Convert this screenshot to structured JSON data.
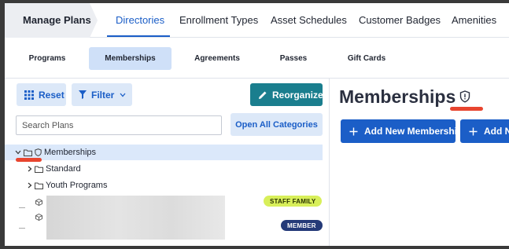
{
  "topnav": {
    "brand": "Manage Plans",
    "tabs": [
      {
        "label": "Directories",
        "active": true
      },
      {
        "label": "Enrollment Types",
        "active": false
      },
      {
        "label": "Asset Schedules",
        "active": false
      },
      {
        "label": "Customer Badges",
        "active": false
      },
      {
        "label": "Amenities",
        "active": false
      }
    ]
  },
  "subnav": {
    "tabs": [
      {
        "label": "Programs",
        "active": false
      },
      {
        "label": "Memberships",
        "active": true
      },
      {
        "label": "Agreements",
        "active": false
      },
      {
        "label": "Passes",
        "active": false
      },
      {
        "label": "Gift Cards",
        "active": false
      }
    ]
  },
  "toolbar": {
    "reset_label": "Reset",
    "filter_label": "Filter",
    "reorganize_label": "Reorganize",
    "open_all_label": "Open All Categories"
  },
  "search": {
    "placeholder": "Search Plans",
    "value": ""
  },
  "tree": {
    "root_label": "Memberships",
    "children": [
      "Standard",
      "Youth Programs"
    ],
    "badges": [
      "STAFF FAMILY",
      "MEMBER"
    ]
  },
  "main": {
    "title": "Memberships",
    "buttons": [
      "Add New Membership",
      "Add N"
    ]
  },
  "colors": {
    "accent": "#1b5ec7",
    "teal": "#1a7e8e",
    "selected_bg": "#dbe8fa",
    "badge_staff": "#d8ef5a",
    "badge_member": "#243a78",
    "annotation": "#e8452f"
  },
  "icons": {
    "grid": "grid-icon",
    "filter": "filter-icon",
    "pencil": "pencil-icon",
    "shield": "shield-icon",
    "folder": "folder-icon",
    "cube": "cube-icon",
    "plus": "plus-icon"
  }
}
